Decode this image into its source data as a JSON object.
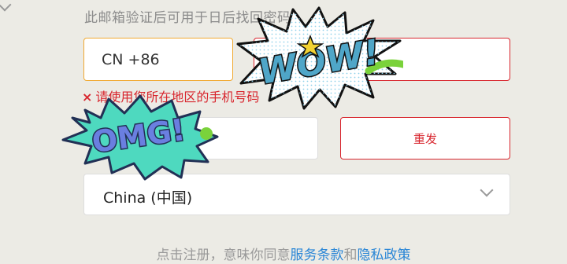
{
  "hint": "此邮箱验证后可用于日后找回密码。",
  "country_code": {
    "value": "CN +86",
    "icon": "chevron-down-icon"
  },
  "phone": {
    "value": ""
  },
  "error": {
    "icon": "×",
    "text": "请使用您所在地区的手机号码"
  },
  "code": {
    "value": ""
  },
  "resend_label": "重发",
  "region": {
    "value": "China (中国)",
    "icon": "chevron-down-icon"
  },
  "terms": {
    "prefix": "点击注册，意味你同意",
    "link1": "服务条款",
    "middle": "和",
    "link2": "隐私政策"
  },
  "stickers": {
    "wow": "WOW!",
    "omg": "OMG!"
  },
  "colors": {
    "background": "#ecebe5",
    "error": "#d8262e",
    "focus": "#f0a830",
    "link": "#2a86d6",
    "wow_fill": "#ffffff",
    "wow_text": "#4fa6c8",
    "omg_fill": "#4ed9bf",
    "omg_text": "#6a7fe0"
  }
}
